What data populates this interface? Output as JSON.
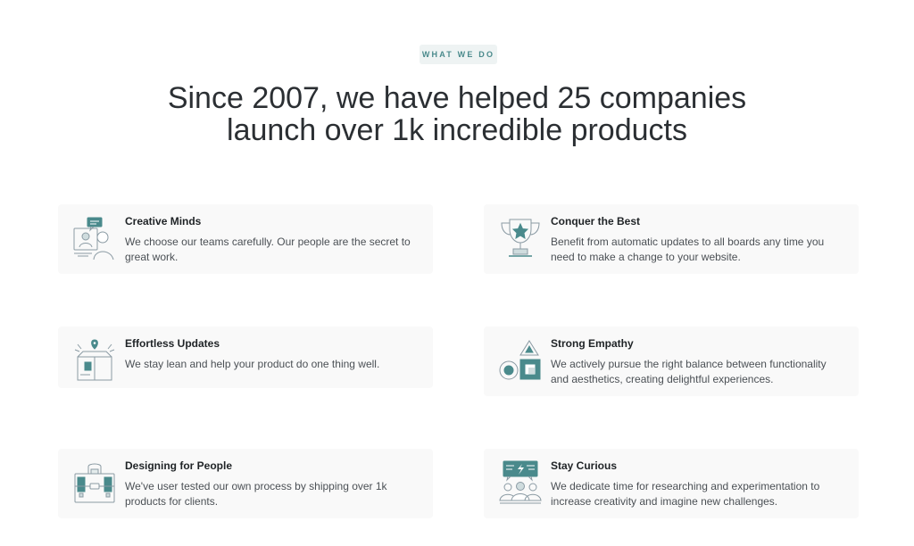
{
  "section": {
    "badge": "WHAT WE DO",
    "headline_line1": "Since 2007, we have helped 25 companies",
    "headline_line2": "launch over 1k incredible products"
  },
  "features": [
    {
      "title": "Creative Minds",
      "description": "We choose our teams carefully. Our people are the secret to great work.",
      "icon": "team-chat-icon"
    },
    {
      "title": "Conquer the Best",
      "description": "Benefit from automatic updates to all boards any time you need to make a change to your website.",
      "icon": "trophy-icon"
    },
    {
      "title": "Effortless Updates",
      "description": "We stay lean and help your product do one thing well.",
      "icon": "open-box-icon"
    },
    {
      "title": "Strong Empathy",
      "description": "We actively pursue the right balance between functionality and aesthetics, creating delightful experiences.",
      "icon": "shapes-icon"
    },
    {
      "title": "Designing for People",
      "description": "We've user tested our own process by shipping over 1k products for clients.",
      "icon": "toolbox-icon"
    },
    {
      "title": "Stay Curious",
      "description": "We dedicate time for researching and experimentation to increase creativity and imagine new challenges.",
      "icon": "group-idea-icon"
    }
  ],
  "colors": {
    "accent": "#4a8a8c",
    "icon_stroke": "#8a9aa3",
    "card_bg": "#f9f9f9",
    "badge_bg": "#eef3f3"
  }
}
